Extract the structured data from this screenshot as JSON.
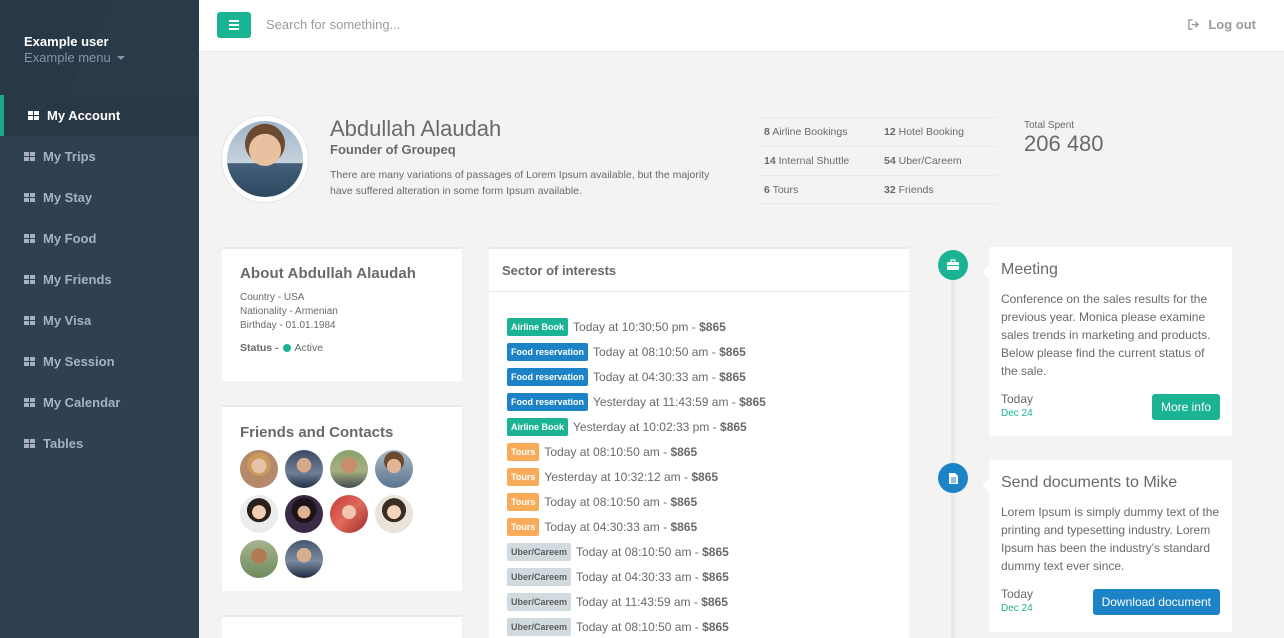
{
  "sidebar": {
    "user_name": "Example user",
    "user_menu": "Example menu",
    "items": [
      {
        "label": "My Account",
        "active": true
      },
      {
        "label": "My Trips"
      },
      {
        "label": "My Stay"
      },
      {
        "label": "My Food"
      },
      {
        "label": "My Friends"
      },
      {
        "label": "My Visa"
      },
      {
        "label": "My Session"
      },
      {
        "label": "My Calendar"
      },
      {
        "label": "Tables"
      }
    ]
  },
  "topbar": {
    "search_placeholder": "Search for something...",
    "logout_label": "Log out"
  },
  "profile": {
    "name": "Abdullah Alaudah",
    "title": "Founder of Groupeq",
    "description": "There are many variations of passages of Lorem Ipsum available, but the majority have suffered alteration in some form Ipsum available."
  },
  "stats": [
    {
      "count": "8",
      "label": "Airline Bookings"
    },
    {
      "count": "12",
      "label": "Hotel Booking"
    },
    {
      "count": "14",
      "label": "Internal Shuttle"
    },
    {
      "count": "54",
      "label": "Uber/Careem"
    },
    {
      "count": "6",
      "label": "Tours"
    },
    {
      "count": "32",
      "label": "Friends"
    }
  ],
  "total": {
    "label": "Total Spent",
    "value": "206 480"
  },
  "about": {
    "title": "About Abdullah Alaudah",
    "country": "Country - USA",
    "nationality": "Nationality - Armenian",
    "birthday": "Birthday - 01.01.1984",
    "status_label": "Status - ",
    "status_value": "Active"
  },
  "friends": {
    "title": "Friends and Contacts",
    "count_shown": 10
  },
  "sector": {
    "title": "Sector of interests",
    "rows": [
      {
        "tag": "Airline Book",
        "tag_color": "green",
        "time": "Today at 10:30:50 pm - ",
        "amount": "$865"
      },
      {
        "tag": "Food reservation",
        "tag_color": "blue",
        "time": "Today at 08:10:50 am - ",
        "amount": "$865"
      },
      {
        "tag": "Food reservation",
        "tag_color": "blue",
        "time": "Today at 04:30:33 am - ",
        "amount": "$865"
      },
      {
        "tag": "Food reservation",
        "tag_color": "blue",
        "time": "Yesterday at 11:43:59 am - ",
        "amount": "$865"
      },
      {
        "tag": "Airline Book",
        "tag_color": "green",
        "time": "Yesterday at 10:02:33 pm - ",
        "amount": "$865"
      },
      {
        "tag": "Tours",
        "tag_color": "orange",
        "time": "Today at 08:10:50 am - ",
        "amount": "$865"
      },
      {
        "tag": "Tours",
        "tag_color": "orange",
        "time": "Yesterday at 10:32:12 am - ",
        "amount": "$865"
      },
      {
        "tag": "Tours",
        "tag_color": "orange",
        "time": "Today at 08:10:50 am - ",
        "amount": "$865"
      },
      {
        "tag": "Tours",
        "tag_color": "orange",
        "time": "Today at 04:30:33 am - ",
        "amount": "$865"
      },
      {
        "tag": "Uber/Careem",
        "tag_color": "grey",
        "time": "Today at 08:10:50 am - ",
        "amount": "$865"
      },
      {
        "tag": "Uber/Careem",
        "tag_color": "grey",
        "time": "Today at 04:30:33 am - ",
        "amount": "$865"
      },
      {
        "tag": "Uber/Careem",
        "tag_color": "grey",
        "time": "Today at 11:43:59 am - ",
        "amount": "$865"
      },
      {
        "tag": "Uber/Careem",
        "tag_color": "grey",
        "time": "Today at 08:10:50 am - ",
        "amount": "$865"
      }
    ]
  },
  "timeline": [
    {
      "icon": "briefcase-icon",
      "title": "Meeting",
      "text": "Conference on the sales results for the previous year. Monica please examine sales trends in marketing and products. Below please find the current status of the sale.",
      "date": "Today",
      "sub": "Dec 24",
      "button": "More info"
    },
    {
      "icon": "document-icon",
      "title": "Send documents to Mike",
      "text": "Lorem Ipsum is simply dummy text of the printing and typesetting industry. Lorem Ipsum has been the industry's standard dummy text ever since.",
      "date": "Today",
      "sub": "Dec 24",
      "button": "Download document"
    }
  ],
  "colors": {
    "accent_green": "#1ab394",
    "accent_blue": "#1c84c6",
    "accent_orange": "#f8ac59",
    "sidebar_bg": "#2f4050"
  }
}
